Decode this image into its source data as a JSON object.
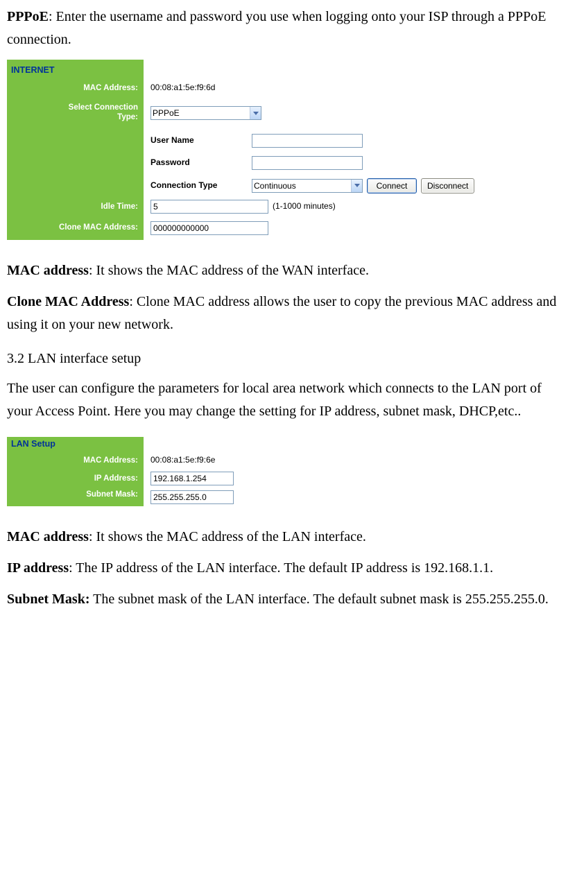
{
  "intro": {
    "pppoe_label": "PPPoE",
    "pppoe_text": ": Enter the username and password you use when logging onto your ISP through a PPPoE connection."
  },
  "internet_panel": {
    "title": "INTERNET",
    "mac_address_label": "MAC Address:",
    "mac_address_value": "00:08:a1:5e:f9:6d",
    "select_conn_type_label": "Select Connection Type:",
    "select_conn_type_value": "PPPoE",
    "user_name_label": "User Name",
    "user_name_value": "",
    "password_label": "Password",
    "password_value": "",
    "connection_type_label": "Connection Type",
    "connection_type_value": "Continuous",
    "connect_btn": "Connect",
    "disconnect_btn": "Disconnect",
    "idle_time_label": "Idle Time:",
    "idle_time_value": "5",
    "idle_time_hint": "(1-1000 minutes)",
    "clone_mac_label": "Clone MAC Address:",
    "clone_mac_value": "000000000000"
  },
  "mid_text": {
    "mac_addr_label": "MAC address",
    "mac_addr_text": ": It shows the MAC address of the WAN interface.",
    "clone_mac_label": "Clone MAC Address",
    "clone_mac_text": ": Clone MAC address allows the user to copy the previous MAC address and using it on your new network.",
    "heading_3_2": "3.2 LAN interface setup",
    "lan_desc": "The user can configure the parameters for local area network which connects to the LAN port of your Access Point. Here you may change the setting for IP address, subnet mask, DHCP,etc.."
  },
  "lan_panel": {
    "title": "LAN Setup",
    "mac_address_label": "MAC Address:",
    "mac_address_value": "00:08:a1:5e:f9:6e",
    "ip_address_label": "IP Address:",
    "ip_address_value": "192.168.1.254",
    "subnet_mask_label": "Subnet Mask:",
    "subnet_mask_value": "255.255.255.0"
  },
  "end_text": {
    "mac_addr_label": "MAC address",
    "mac_addr_text": ": It shows the MAC address of the LAN interface.",
    "ip_addr_label": "IP address",
    "ip_addr_text": ": The IP address of the LAN interface. The default IP address is 192.168.1.1.",
    "subnet_label": "Subnet Mask:",
    "subnet_text": " The subnet mask of the LAN interface. The default subnet mask is 255.255.255.0."
  }
}
